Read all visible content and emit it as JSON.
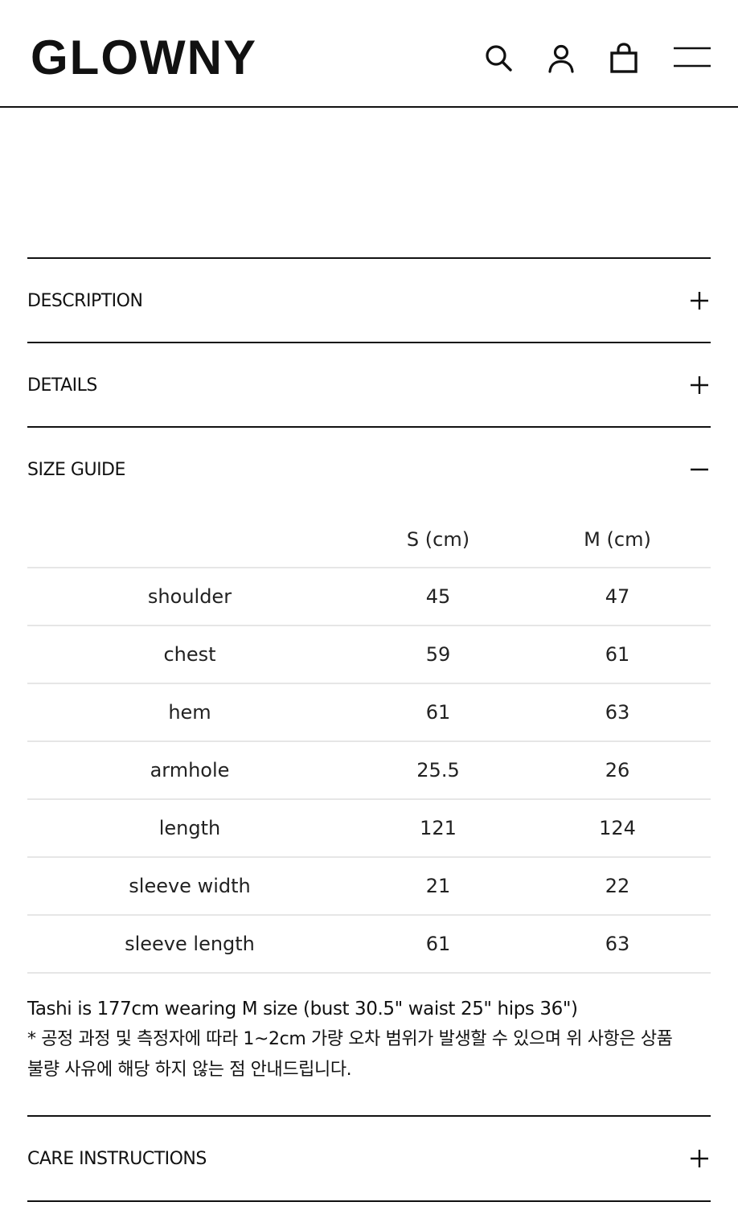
{
  "header": {
    "logo": "GLOWNY",
    "icons": [
      "search-icon",
      "account-icon",
      "shopping-bag-icon",
      "menu-icon"
    ]
  },
  "accordion": {
    "description": {
      "title": "DESCRIPTION",
      "state_icon": "plus-icon"
    },
    "details": {
      "title": "DETAILS",
      "state_icon": "plus-icon"
    },
    "size_guide": {
      "title": "SIZE GUIDE",
      "state_icon": "minus-icon"
    },
    "care": {
      "title": "CARE INSTRUCTIONS",
      "state_icon": "plus-icon"
    }
  },
  "size_table": {
    "columns": [
      "",
      "S (cm)",
      "M (cm)"
    ],
    "rows": [
      {
        "label": "shoulder",
        "s": "45",
        "m": "47"
      },
      {
        "label": "chest",
        "s": "59",
        "m": "61"
      },
      {
        "label": "hem",
        "s": "61",
        "m": "63"
      },
      {
        "label": "armhole",
        "s": "25.5",
        "m": "26"
      },
      {
        "label": "length",
        "s": "121",
        "m": "124"
      },
      {
        "label": "sleeve width",
        "s": "21",
        "m": "22"
      },
      {
        "label": "sleeve length",
        "s": "61",
        "m": "63"
      }
    ]
  },
  "notes": {
    "model": "Tashi is 177cm wearing M size (bust 30.5\" waist 25\" hips 36\")",
    "disclaimer_line1": "* 공정 과정 및 측정자에 따라 1~2cm 가량 오차 범위가 발생할 수 있으며 위 사항은 상품",
    "disclaimer_line2": "불량 사유에 해당 하지 않는 점 안내드립니다."
  },
  "colors": {
    "text": "#111111",
    "divider": "#111111",
    "table_rule": "#e6e6e6",
    "background": "#ffffff"
  }
}
